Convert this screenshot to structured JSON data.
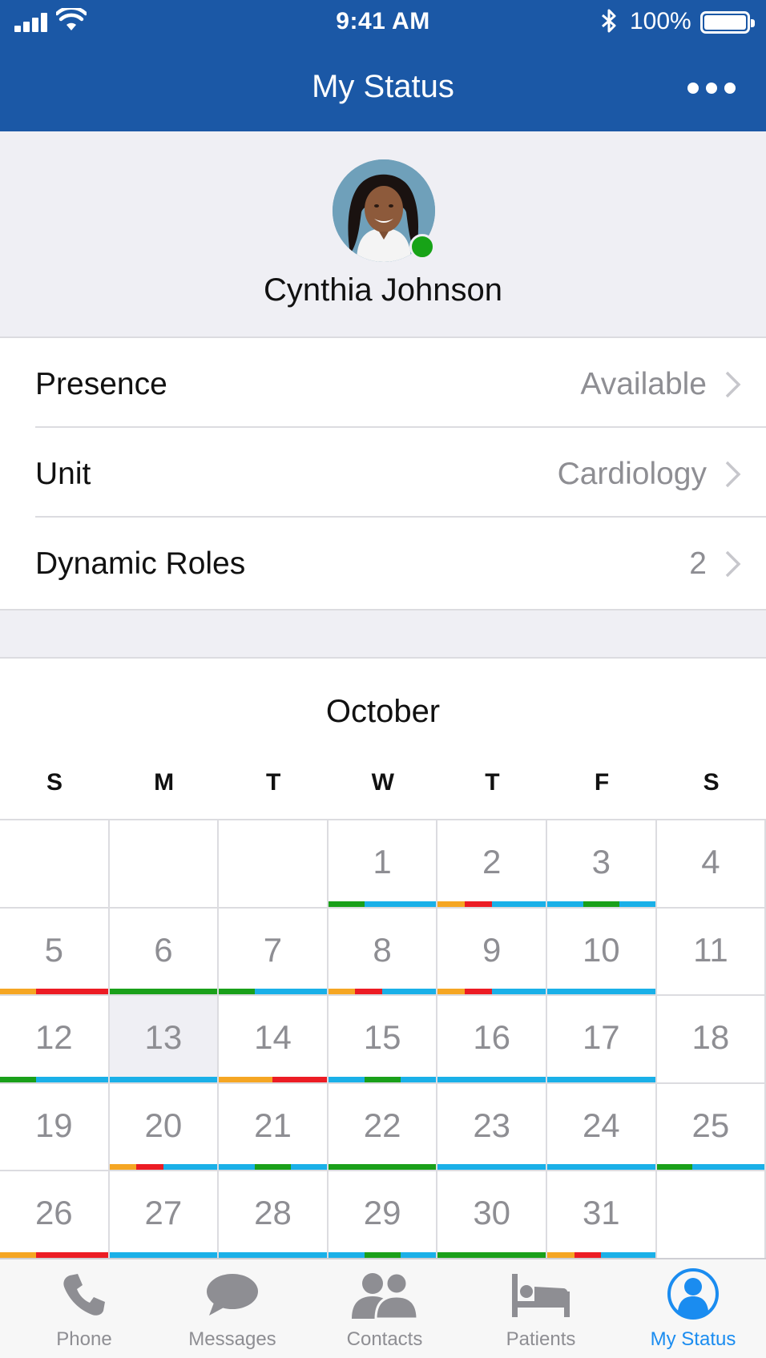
{
  "status_bar": {
    "time": "9:41 AM",
    "battery": "100%"
  },
  "nav": {
    "title": "My Status"
  },
  "profile": {
    "name": "Cynthia Johnson",
    "presence_color": "#17a317"
  },
  "settings": [
    {
      "label": "Presence",
      "value": "Available",
      "key": "presence"
    },
    {
      "label": "Unit",
      "value": "Cardiology",
      "key": "unit"
    },
    {
      "label": "Dynamic Roles",
      "value": "2",
      "key": "dynamic-roles"
    }
  ],
  "calendar": {
    "month": "October",
    "weekdays": [
      "S",
      "M",
      "T",
      "W",
      "T",
      "F",
      "S"
    ],
    "first_weekday_index": 3,
    "days_in_month": 31,
    "selected_day": 13,
    "shift_colors": {
      "orange": "#f5a623",
      "red": "#ec1c24",
      "green": "#1aa01a",
      "blue": "#1ab0e8"
    },
    "day_shifts": {
      "1": [
        "green",
        "blue",
        "blue"
      ],
      "2": [
        "orange",
        "red",
        "blue",
        "blue"
      ],
      "3": [
        "blue",
        "green",
        "blue"
      ],
      "5": [
        "orange",
        "red",
        "red"
      ],
      "6": [
        "green"
      ],
      "7": [
        "green",
        "blue",
        "blue"
      ],
      "8": [
        "orange",
        "red",
        "blue",
        "blue"
      ],
      "9": [
        "orange",
        "red",
        "blue",
        "blue"
      ],
      "10": [
        "blue"
      ],
      "12": [
        "green",
        "blue",
        "blue"
      ],
      "13": [
        "blue"
      ],
      "14": [
        "orange",
        "orange",
        "red",
        "red"
      ],
      "15": [
        "blue",
        "green",
        "blue"
      ],
      "16": [
        "blue"
      ],
      "17": [
        "blue"
      ],
      "20": [
        "orange",
        "red",
        "blue",
        "blue"
      ],
      "21": [
        "blue",
        "green",
        "blue"
      ],
      "22": [
        "green"
      ],
      "23": [
        "blue"
      ],
      "24": [
        "blue"
      ],
      "25": [
        "green",
        "blue",
        "blue"
      ],
      "26": [
        "orange",
        "red",
        "red"
      ],
      "27": [
        "blue"
      ],
      "28": [
        "blue"
      ],
      "29": [
        "blue",
        "green",
        "blue"
      ],
      "30": [
        "green"
      ],
      "31": [
        "orange",
        "red",
        "blue",
        "blue"
      ]
    }
  },
  "tabs": [
    {
      "label": "Phone",
      "icon": "phone-icon",
      "active": false
    },
    {
      "label": "Messages",
      "icon": "messages-icon",
      "active": false
    },
    {
      "label": "Contacts",
      "icon": "contacts-icon",
      "active": false
    },
    {
      "label": "Patients",
      "icon": "patients-icon",
      "active": false
    },
    {
      "label": "My Status",
      "icon": "my-status-icon",
      "active": true
    }
  ],
  "colors": {
    "nav_bg": "#1b58a6",
    "accent": "#1a8cf0",
    "muted": "#8e8e93",
    "grouped_bg": "#efeff4"
  }
}
